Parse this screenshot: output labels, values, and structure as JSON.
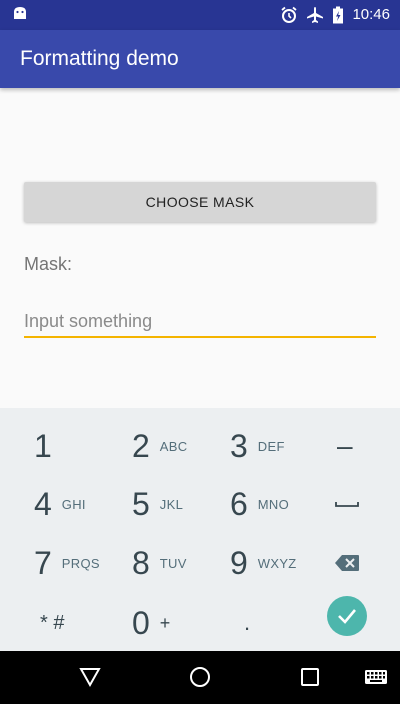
{
  "colors": {
    "status_bar": "#283593",
    "app_bar": "#3949ab",
    "accent": "#f4b400",
    "done_key": "#4db6ac",
    "keyboard_bg": "#eceff1"
  },
  "status_bar": {
    "time": "10:46",
    "icons": [
      "android-icon",
      "alarm-icon",
      "airplane-icon",
      "battery-icon"
    ]
  },
  "app_bar": {
    "title": "Formatting demo"
  },
  "main": {
    "choose_mask_label": "CHOOSE MASK",
    "mask_label": "Mask:",
    "input_placeholder": "Input something",
    "input_value": ""
  },
  "keyboard": {
    "rows": [
      [
        {
          "main": "1",
          "sub": ""
        },
        {
          "main": "2",
          "sub": "ABC"
        },
        {
          "main": "3",
          "sub": "DEF"
        },
        {
          "main": "–",
          "sub": ""
        }
      ],
      [
        {
          "main": "4",
          "sub": "GHI"
        },
        {
          "main": "5",
          "sub": "JKL"
        },
        {
          "main": "6",
          "sub": "MNO"
        },
        {
          "main": "space-icon",
          "sub": ""
        }
      ],
      [
        {
          "main": "7",
          "sub": "PRQS"
        },
        {
          "main": "8",
          "sub": "TUV"
        },
        {
          "main": "9",
          "sub": "WXYZ"
        },
        {
          "main": "backspace-icon",
          "sub": ""
        }
      ],
      [
        {
          "main": "* #",
          "sub": ""
        },
        {
          "main": "0",
          "sub": "+"
        },
        {
          "main": ".",
          "sub": ""
        },
        {
          "main": "check-icon",
          "sub": ""
        }
      ]
    ]
  },
  "nav_bar": {
    "buttons": [
      "back-icon",
      "home-icon",
      "recents-icon",
      "keyboard-icon"
    ]
  }
}
